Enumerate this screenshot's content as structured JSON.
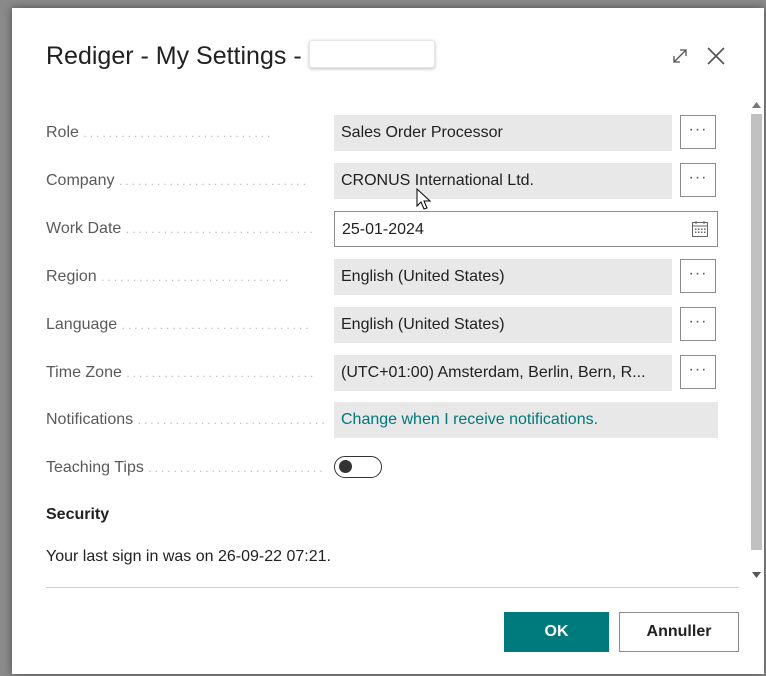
{
  "dialog": {
    "title_prefix": "Rediger - My Settings - ",
    "expand_icon": "expand-diagonal-icon",
    "close_icon": "close-icon"
  },
  "fields": {
    "role": {
      "label": "Role",
      "value": "Sales Order Processor"
    },
    "company": {
      "label": "Company",
      "value": "CRONUS International Ltd."
    },
    "work_date": {
      "label": "Work Date",
      "value": "25-01-2024"
    },
    "region": {
      "label": "Region",
      "value": "English (United States)"
    },
    "language": {
      "label": "Language",
      "value": "English (United States)"
    },
    "time_zone": {
      "label": "Time Zone",
      "value": "(UTC+01:00) Amsterdam, Berlin, Bern, R..."
    },
    "notifications": {
      "label": "Notifications",
      "value": "Change when I receive notifications."
    },
    "teaching_tips": {
      "label": "Teaching Tips",
      "enabled": false
    }
  },
  "more_button_label": "···",
  "dots": "..............................",
  "security": {
    "title": "Security",
    "last_signin": "Your last sign in was on 26-09-22 07:21."
  },
  "buttons": {
    "ok": "OK",
    "cancel": "Annuller"
  },
  "colors": {
    "accent": "#007b7d",
    "link": "#00787a",
    "field_bg": "#e8e8e8"
  }
}
